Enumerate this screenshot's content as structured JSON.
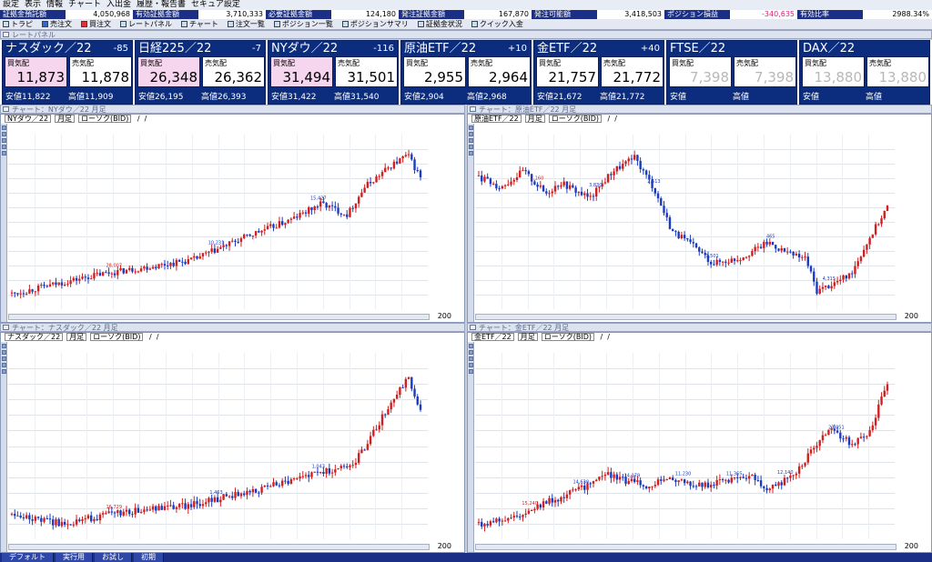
{
  "menu": [
    "設定",
    "表示",
    "情報",
    "チャート",
    "入出金",
    "履歴・報告書",
    "セキュア設定"
  ],
  "status": [
    {
      "label": "証拠金預託額",
      "value": "4,050,968"
    },
    {
      "label": "有効証拠金額",
      "value": "3,710,333"
    },
    {
      "label": "必要証拠金額",
      "value": "124,180"
    },
    {
      "label": "発注証拠金額",
      "value": "167,870"
    },
    {
      "label": "発注可能額",
      "value": "3,418,503"
    },
    {
      "label": "ポジション損益",
      "value": "-340,635",
      "color": "#e0207a"
    },
    {
      "label": "有効比率",
      "value": "2988.34%"
    }
  ],
  "toolbar": [
    "トラピ",
    "売注文",
    "買注文",
    "レートパネル",
    "チャート",
    "注文一覧",
    "ポジション一覧",
    "ポジションサマリ",
    "証拠金状況",
    "クイック入金"
  ],
  "trade_panel_title": "レートパネル",
  "bid_label": "買気配",
  "ask_label": "売気配",
  "low_label": "安値",
  "high_label": "高値",
  "instruments": [
    {
      "name": "ナスダック／22",
      "change": "-85",
      "bid": "11,873",
      "ask": "11,878",
      "low": "11,822",
      "high": "11,909",
      "active": true
    },
    {
      "name": "日経225／22",
      "change": "-7",
      "bid": "26,348",
      "ask": "26,362",
      "low": "26,195",
      "high": "26,393",
      "active": true
    },
    {
      "name": "NYダウ／22",
      "change": "-116",
      "bid": "31,494",
      "ask": "31,501",
      "low": "31,422",
      "high": "31,540",
      "active": true
    },
    {
      "name": "原油ETF／22",
      "change": "+10",
      "bid": "2,955",
      "ask": "2,964",
      "low": "2,904",
      "high": "2,968",
      "active": false
    },
    {
      "name": "金ETF／22",
      "change": "+40",
      "bid": "21,757",
      "ask": "21,772",
      "low": "21,672",
      "high": "21,772",
      "active": false
    },
    {
      "name": "FTSE／22",
      "change": "",
      "bid": "7,398",
      "ask": "7,398",
      "low": "",
      "high": "",
      "active": false,
      "gray": true
    },
    {
      "name": "DAX／22",
      "change": "",
      "bid": "13,880",
      "ask": "13,880",
      "low": "",
      "high": "",
      "active": false,
      "gray": true
    }
  ],
  "charts": [
    {
      "title": "チャート：NYダウ／22 月足",
      "symbol": "NYダウ／22",
      "period": "月足",
      "ctype": "ローソク(BID)",
      "zoom": "200",
      "annotations": [
        "28,007",
        "10,231",
        "15,427"
      ]
    },
    {
      "title": "チャート：原油ETF／22 月足",
      "symbol": "原油ETF／22",
      "period": "月足",
      "ctype": "ローソク(BID)",
      "zoom": "200",
      "annotations": [
        "7,160",
        "3,830",
        "2,513",
        "1,501",
        "465",
        "4,315"
      ]
    },
    {
      "title": "チャート：ナスダック／22 月足",
      "symbol": "ナスダック／22",
      "period": "月足",
      "ctype": "ローソク(BID)",
      "zoom": "200",
      "annotations": [
        "16,729",
        "1,463",
        "1,043"
      ]
    },
    {
      "title": "チャート：金ETF／22 月足",
      "symbol": "金ETF／22",
      "period": "月足",
      "ctype": "ローソク(BID)",
      "zoom": "200",
      "annotations": [
        "15,240",
        "14,630",
        "14,179",
        "11,230",
        "11,365",
        "12,140",
        "23,051"
      ]
    }
  ],
  "bottom_tabs": [
    "デフォルト",
    "実行用",
    "お試し",
    "初期"
  ],
  "colors": {
    "up": "#d21f1f",
    "down": "#1b3cc2",
    "panel": "#0c2d7e",
    "bid_box": "#f6d6ee"
  }
}
